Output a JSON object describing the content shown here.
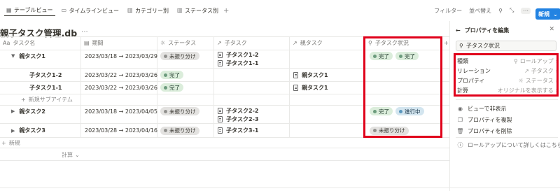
{
  "tabs": [
    {
      "icon": "table-icon",
      "label": "テーブルビュー"
    },
    {
      "icon": "timeline-icon",
      "label": "タイムラインビュー"
    },
    {
      "icon": "board-icon",
      "label": "カテゴリー別"
    },
    {
      "icon": "board-icon",
      "label": "ステータス別"
    }
  ],
  "toolbar": {
    "filter": "フィルター",
    "sort": "並べ替え",
    "new": "新規"
  },
  "page_title": "親子タスク管理.db",
  "columns": {
    "name": "タスク名",
    "period": "期間",
    "status": "ステータス",
    "child": "子タスク",
    "parent": "親タスク",
    "child_status": "子タスク状況"
  },
  "rows": {
    "r1": {
      "name": "親タスク1",
      "period": "2023/03/18 → 2023/03/29",
      "status": "未振り分け",
      "child1": "子タスク1-2",
      "child2": "子タスク1-1",
      "cs1": "完了",
      "cs2": "完了"
    },
    "r1a": {
      "name": "子タスク1-2",
      "period": "2023/03/22 → 2023/03/26",
      "status": "完了",
      "parent": "親タスク1"
    },
    "r1b": {
      "name": "子タスク1-1",
      "period": "2023/03/22 → 2023/03/26",
      "status": "完了",
      "parent": "親タスク1"
    },
    "r2": {
      "name": "親タスク2",
      "period": "2023/03/18 → 2023/04/05",
      "status": "未振り分け",
      "child1": "子タスク2-2",
      "child2": "子タスク2-3",
      "cs1": "完了",
      "cs2": "進行中"
    },
    "r3": {
      "name": "親タスク3",
      "period": "2023/03/28 → 2023/04/16",
      "status": "未振り分け",
      "child1": "子タスク3-1",
      "cs1": "未振り分け"
    }
  },
  "new_subitem": "新規サブアイテム",
  "new_row": "新規",
  "calc": "計算",
  "panel": {
    "title": "プロパティを編集",
    "search_value": "子タスク状況",
    "props": [
      {
        "label": "種類",
        "value": "ロールアップ"
      },
      {
        "label": "リレーション",
        "value": "子タスク"
      },
      {
        "label": "プロパティ",
        "value": "ステータス"
      },
      {
        "label": "計算",
        "value": "オリジナルを表示する"
      }
    ],
    "actions": {
      "hide": "ビューで非表示",
      "duplicate": "プロパティを複製",
      "delete": "プロパティを削除",
      "learn": "ロールアップについて詳しくはこちら"
    }
  },
  "colors": {
    "accent": "#2383e2",
    "highlight": "#e0001a",
    "done": "#dbeddb",
    "progress": "#d3e5ef",
    "unassigned": "#e3e2e0"
  }
}
